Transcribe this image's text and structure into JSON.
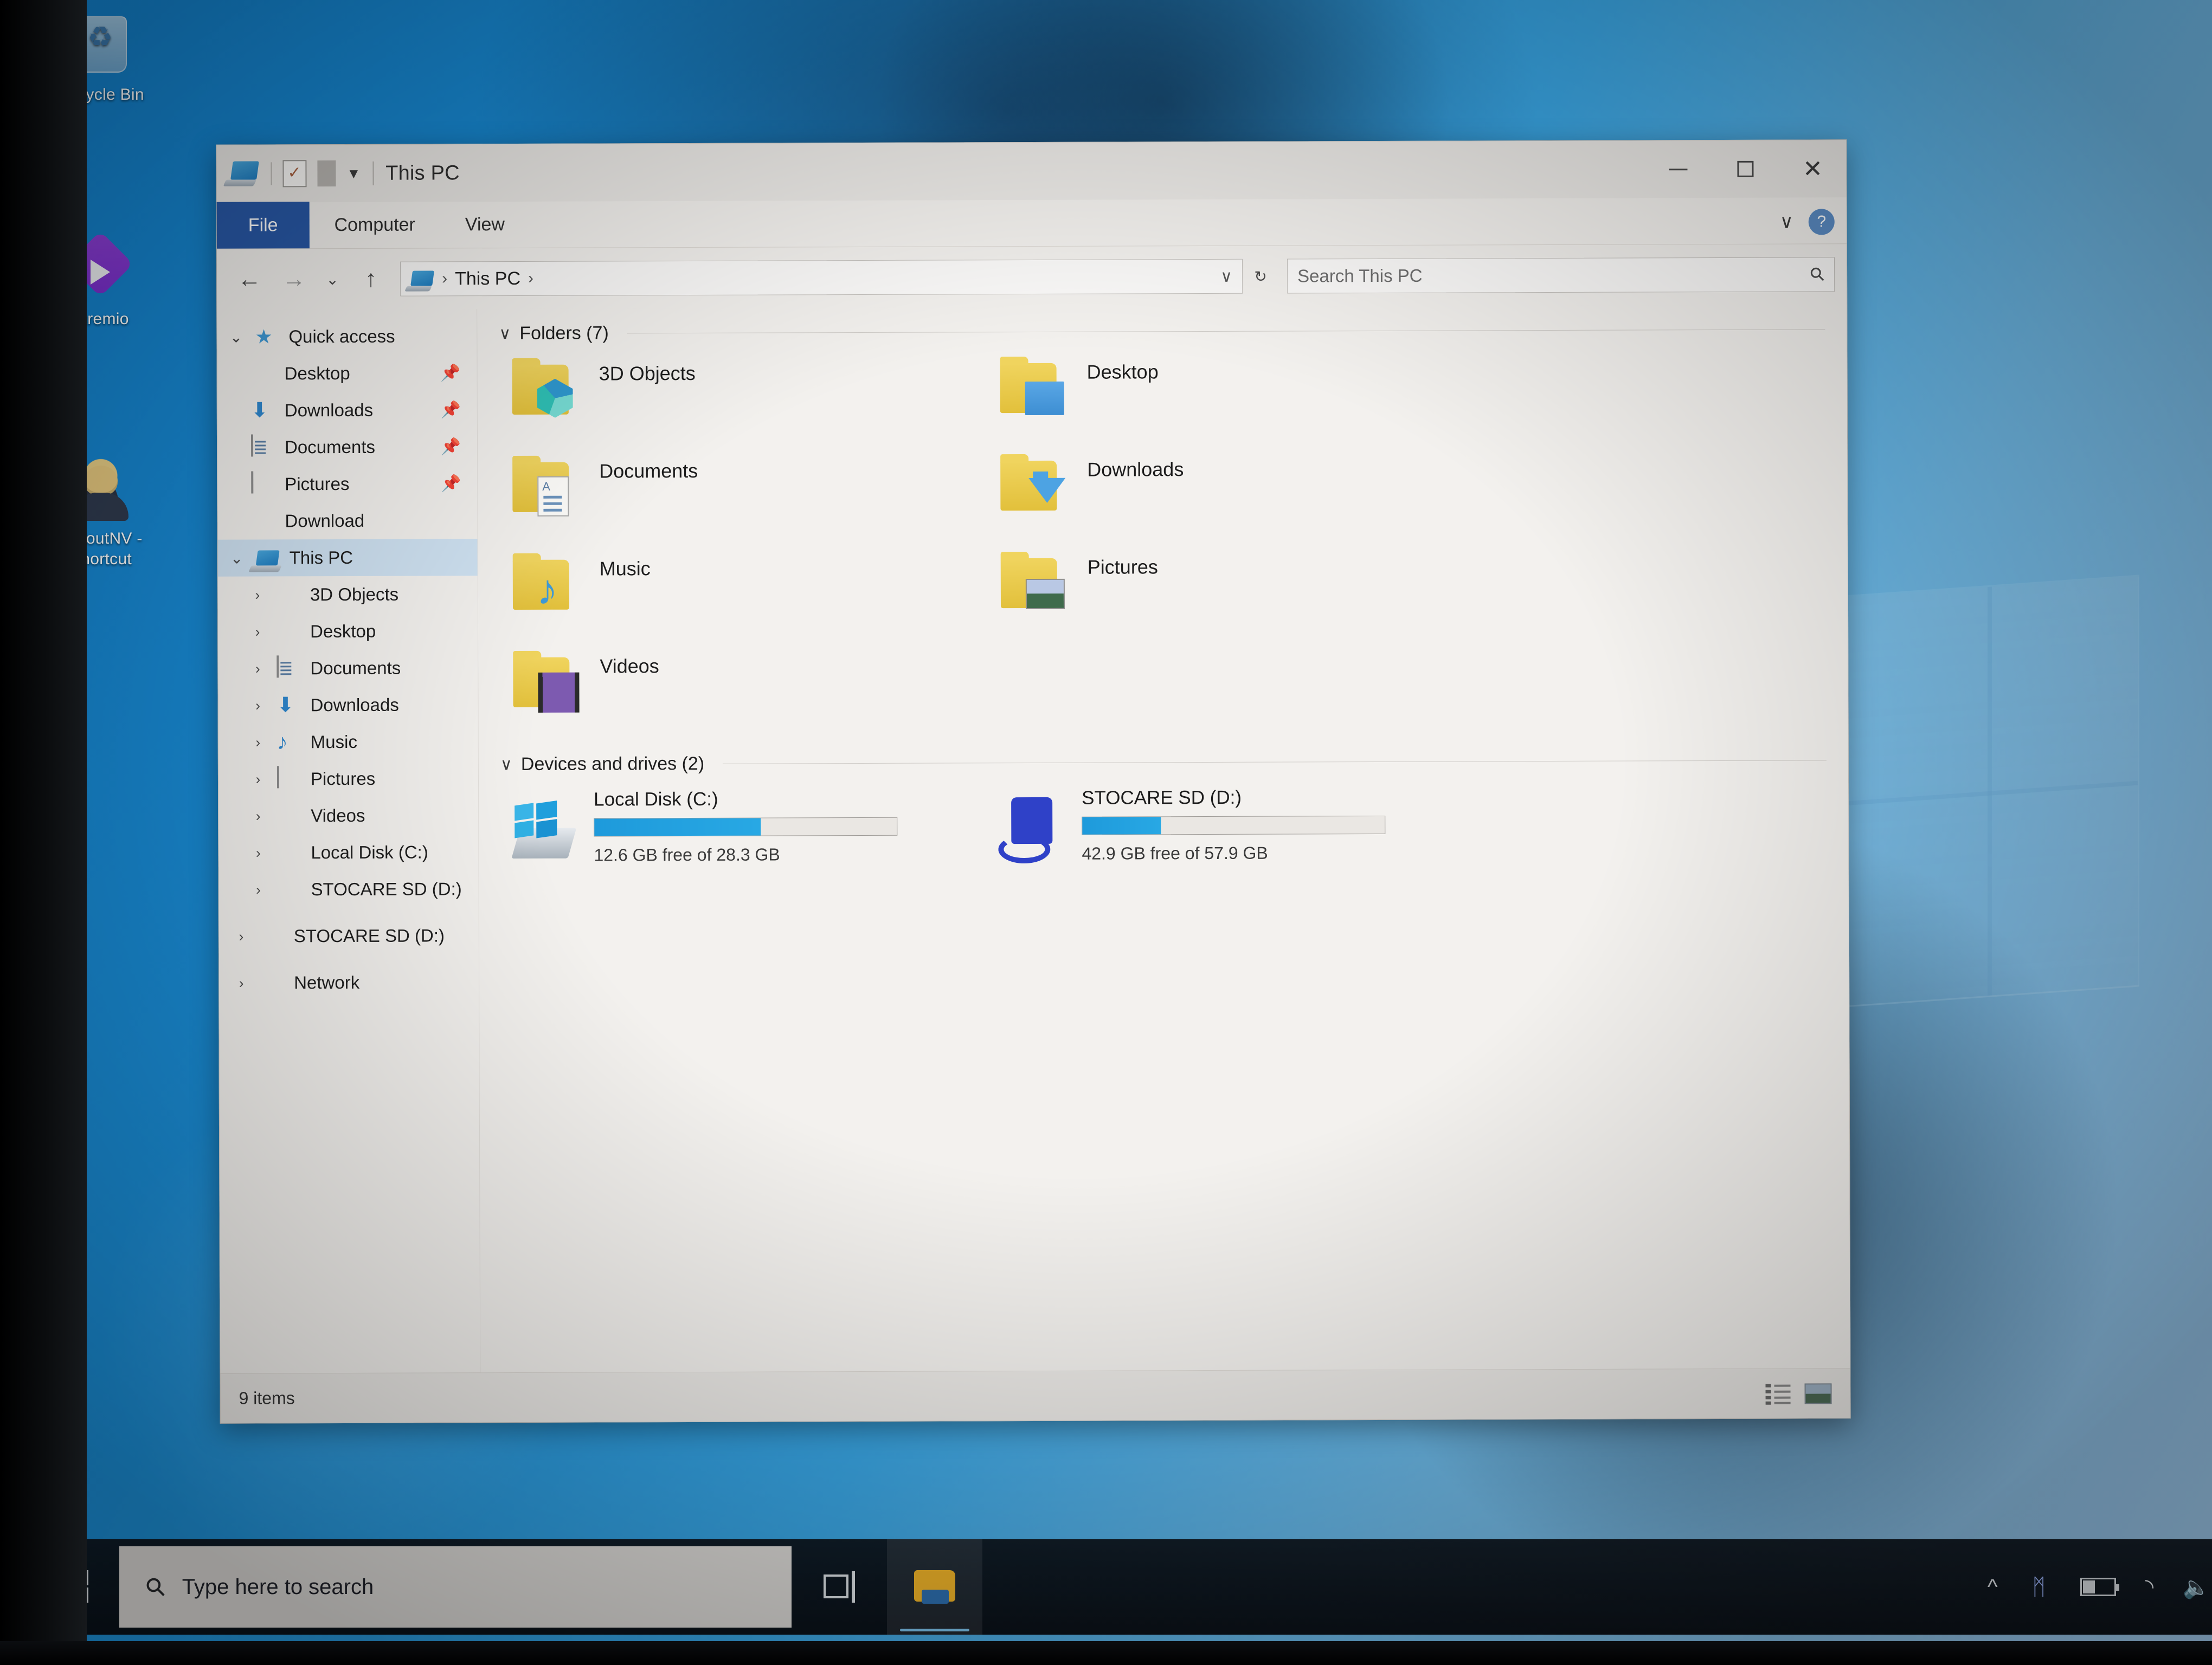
{
  "desktop": {
    "icons": [
      {
        "label": "Recycle Bin",
        "icon": "recycle-bin-icon"
      },
      {
        "label": "Stremio",
        "icon": "stremio-icon"
      },
      {
        "label": "FalloutNV - Shortcut",
        "icon": "falloutnv-shortcut-icon"
      }
    ]
  },
  "window": {
    "title": "This PC",
    "quick_access_toolbar": [
      {
        "name": "this-pc-icon",
        "glyph": "pc"
      },
      {
        "name": "properties-icon",
        "glyph": "check-page"
      },
      {
        "name": "new-folder-icon",
        "glyph": "page"
      },
      {
        "name": "customize-qat-caret",
        "glyph": "caret-down"
      }
    ],
    "controls": {
      "minimize": "–",
      "maximize": "□",
      "close": "✕",
      "ribbon_expand": "∨",
      "help": "?"
    },
    "tabs": [
      {
        "label": "File",
        "active": true
      },
      {
        "label": "Computer",
        "active": false
      },
      {
        "label": "View",
        "active": false
      }
    ],
    "addressbar": {
      "back": "←",
      "forward": "→",
      "recent": "⌄",
      "up": "↑",
      "breadcrumb": [
        "This PC"
      ],
      "breadcrumb_separator": "›",
      "history_caret": "∨",
      "refresh": "↻"
    },
    "search": {
      "placeholder": "Search This PC",
      "icon": "search-icon"
    },
    "status": {
      "items_text": "9 items",
      "view_details": "details-view-icon",
      "view_large": "large-icons-view-icon"
    }
  },
  "sidebar": {
    "quick_access": {
      "label": "Quick access",
      "expanded": true,
      "items": [
        {
          "label": "Desktop",
          "icon": "desktop-icon",
          "pinned": true
        },
        {
          "label": "Downloads",
          "icon": "downloads-icon",
          "pinned": true
        },
        {
          "label": "Documents",
          "icon": "documents-icon",
          "pinned": true
        },
        {
          "label": "Pictures",
          "icon": "pictures-icon",
          "pinned": true
        },
        {
          "label": "Download",
          "icon": "folder-icon",
          "pinned": false
        }
      ]
    },
    "this_pc": {
      "label": "This PC",
      "expanded": true,
      "selected": true,
      "items": [
        {
          "label": "3D Objects",
          "icon": "3d-objects-icon"
        },
        {
          "label": "Desktop",
          "icon": "desktop-icon"
        },
        {
          "label": "Documents",
          "icon": "documents-icon"
        },
        {
          "label": "Downloads",
          "icon": "downloads-icon"
        },
        {
          "label": "Music",
          "icon": "music-icon"
        },
        {
          "label": "Pictures",
          "icon": "pictures-icon"
        },
        {
          "label": "Videos",
          "icon": "videos-icon"
        },
        {
          "label": "Local Disk (C:)",
          "icon": "hard-drive-icon"
        },
        {
          "label": "STOCARE SD (D:)",
          "icon": "sd-card-icon"
        }
      ]
    },
    "removable": [
      {
        "label": "STOCARE SD (D:)",
        "icon": "sd-card-icon"
      }
    ],
    "network": {
      "label": "Network",
      "icon": "network-icon"
    }
  },
  "main": {
    "folders_group": {
      "header": "Folders (7)",
      "collapse_caret": "∨",
      "items": [
        {
          "label": "3D Objects",
          "icon": "3d-objects-folder-icon"
        },
        {
          "label": "Desktop",
          "icon": "desktop-folder-icon"
        },
        {
          "label": "Documents",
          "icon": "documents-folder-icon"
        },
        {
          "label": "Downloads",
          "icon": "downloads-folder-icon"
        },
        {
          "label": "Music",
          "icon": "music-folder-icon"
        },
        {
          "label": "Pictures",
          "icon": "pictures-folder-icon"
        },
        {
          "label": "Videos",
          "icon": "videos-folder-icon"
        }
      ]
    },
    "drives_group": {
      "header": "Devices and drives (2)",
      "collapse_caret": "∨",
      "items": [
        {
          "name": "Local Disk (C:)",
          "icon": "local-disk-icon",
          "free_text": "12.6 GB free of 28.3 GB",
          "free_gb": 12.6,
          "total_gb": 28.3,
          "used_percent": 55
        },
        {
          "name": "STOCARE SD (D:)",
          "icon": "sd-card-drive-icon",
          "free_text": "42.9 GB free of 57.9 GB",
          "free_gb": 42.9,
          "total_gb": 57.9,
          "used_percent": 26
        }
      ]
    }
  },
  "taskbar": {
    "start": "start-button",
    "search_placeholder": "Type here to search",
    "search_icon": "search-icon",
    "task_view": "task-view-icon",
    "pinned": [
      {
        "name": "file-explorer-taskbar-icon",
        "active": true
      }
    ],
    "tray": [
      {
        "name": "show-hidden-icons-chevron",
        "glyph": "⌃"
      },
      {
        "name": "bluetooth-icon",
        "glyph": "ᛗ"
      },
      {
        "name": "battery-icon",
        "glyph": "battery"
      },
      {
        "name": "wifi-icon",
        "glyph": "◠"
      },
      {
        "name": "volume-icon",
        "glyph": "ὐA"
      }
    ]
  },
  "colors": {
    "accent_blue": "#2858a6",
    "selection_blue": "#cfe2f2",
    "drive_bar_blue": "#1e9adb",
    "folder_yellow": "#e2c03b",
    "taskbar_dark": "#0d141c"
  }
}
